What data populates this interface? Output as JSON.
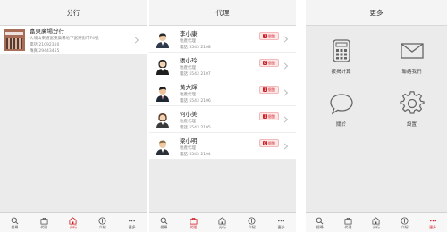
{
  "screens": {
    "branch": {
      "title": "分行",
      "branch": {
        "name": "富東廣場分行",
        "address": "大埔山東道富東廣場地下富東街市F4號",
        "phone": "電話 21092310",
        "fax": "傳真 29443455"
      }
    },
    "agents": {
      "title": "代理",
      "items": [
        {
          "name": "李小康",
          "title": "地產代理",
          "phone": "電話 5543 2108",
          "badge_num": "1",
          "badge_label": "個盤"
        },
        {
          "name": "張小玲",
          "title": "地產代理",
          "phone": "電話 5543 2107",
          "badge_num": "0",
          "badge_label": "個盤"
        },
        {
          "name": "黃大輝",
          "title": "地產代理",
          "phone": "電話 5543 2106",
          "badge_num": "1",
          "badge_label": "個盤"
        },
        {
          "name": "何小美",
          "title": "地產代理",
          "phone": "電話 5543 2105",
          "badge_num": "1",
          "badge_label": "個盤"
        },
        {
          "name": "梁小明",
          "title": "地產代理",
          "phone": "電話 5543 2104",
          "badge_num": "0",
          "badge_label": "個盤"
        }
      ]
    },
    "more": {
      "title": "更多",
      "items": [
        {
          "label": "按揭計算",
          "icon": "calculator-icon"
        },
        {
          "label": "聯絡我們",
          "icon": "mail-icon"
        },
        {
          "label": "關於",
          "icon": "chat-bubble-icon"
        },
        {
          "label": "設置",
          "icon": "gear-icon"
        }
      ]
    }
  },
  "tabbar": {
    "items": [
      {
        "label": "搜尋",
        "icon": "search-icon"
      },
      {
        "label": "代理",
        "icon": "briefcase-icon"
      },
      {
        "label": "分行",
        "icon": "branch-icon"
      },
      {
        "label": "介紹",
        "icon": "info-icon"
      },
      {
        "label": "更多",
        "icon": "more-dots-icon"
      }
    ]
  },
  "colors": {
    "accent": "#d21f26",
    "header_bg": "#f4f4f4",
    "screen_bg": "#ebebeb"
  }
}
